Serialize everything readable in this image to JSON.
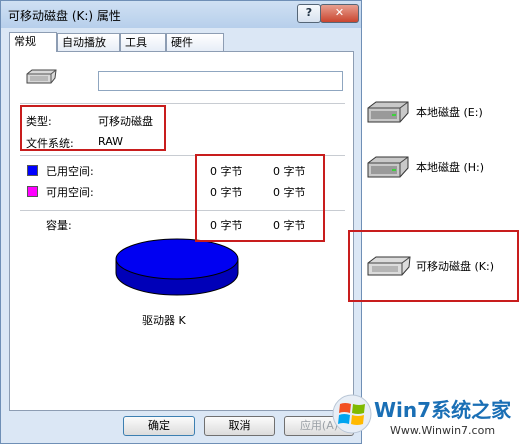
{
  "window": {
    "title": "可移动磁盘 (K:) 属性",
    "help_label": "?",
    "close_label": "✕"
  },
  "tabs": [
    "常规",
    "自动播放",
    "工具",
    "硬件"
  ],
  "general": {
    "drive_name_value": "",
    "type_label": "类型:",
    "type_value": "可移动磁盘",
    "fs_label": "文件系统:",
    "fs_value": "RAW",
    "used_label": "已用空间:",
    "used_bytes": "0 字节",
    "used_size": "0 字节",
    "free_label": "可用空间:",
    "free_bytes": "0 字节",
    "free_size": "0 字节",
    "capacity_label": "容量:",
    "capacity_bytes": "0 字节",
    "capacity_size": "0 字节",
    "drive_caption": "驱动器 K",
    "used_color": "#0000ff",
    "free_color": "#ff00ff"
  },
  "buttons": {
    "ok": "确定",
    "cancel": "取消",
    "apply": "应用(A)"
  },
  "desktop": {
    "drives": [
      {
        "label": "本地磁盘 (E:)",
        "icon": "hard-drive-icon"
      },
      {
        "label": "本地磁盘 (H:)",
        "icon": "hard-drive-icon"
      },
      {
        "label": "可移动磁盘 (K:)",
        "icon": "removable-drive-icon"
      }
    ]
  },
  "watermark": {
    "brand": "Win7系统之家",
    "url": "Www.Winwin7.com"
  }
}
